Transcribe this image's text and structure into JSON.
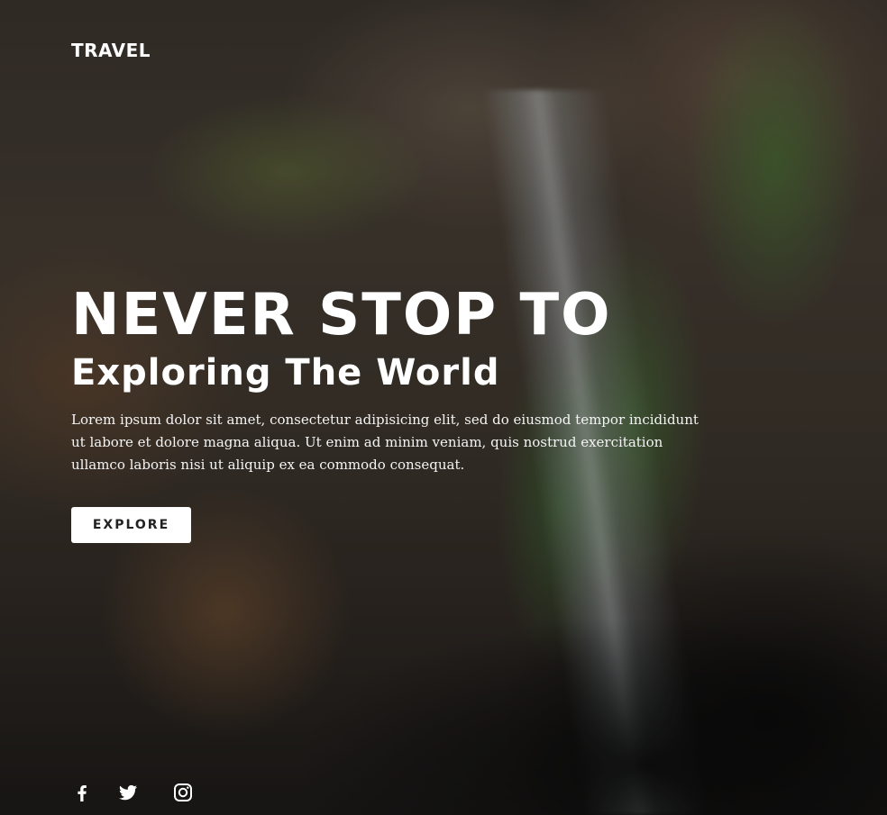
{
  "header": {
    "brand": "TRAVEL"
  },
  "hero": {
    "title_line_1": "NEVER STOP TO",
    "title_line_2": "Exploring The World",
    "body": "Lorem ipsum dolor sit amet, consectetur adipisicing elit, sed do eiusmod tempor incididunt ut labore et dolore magna aliqua. Ut enim ad minim veniam, quis nostrud exercitation ullamco laboris nisi ut aliquip ex ea commodo consequat.",
    "cta_label": "EXPLORE"
  },
  "social": {
    "icons": [
      "facebook-icon",
      "twitter-icon",
      "instagram-icon"
    ]
  },
  "colors": {
    "button_bg": "#ffffff",
    "button_text": "#222222",
    "text": "#ffffff"
  }
}
